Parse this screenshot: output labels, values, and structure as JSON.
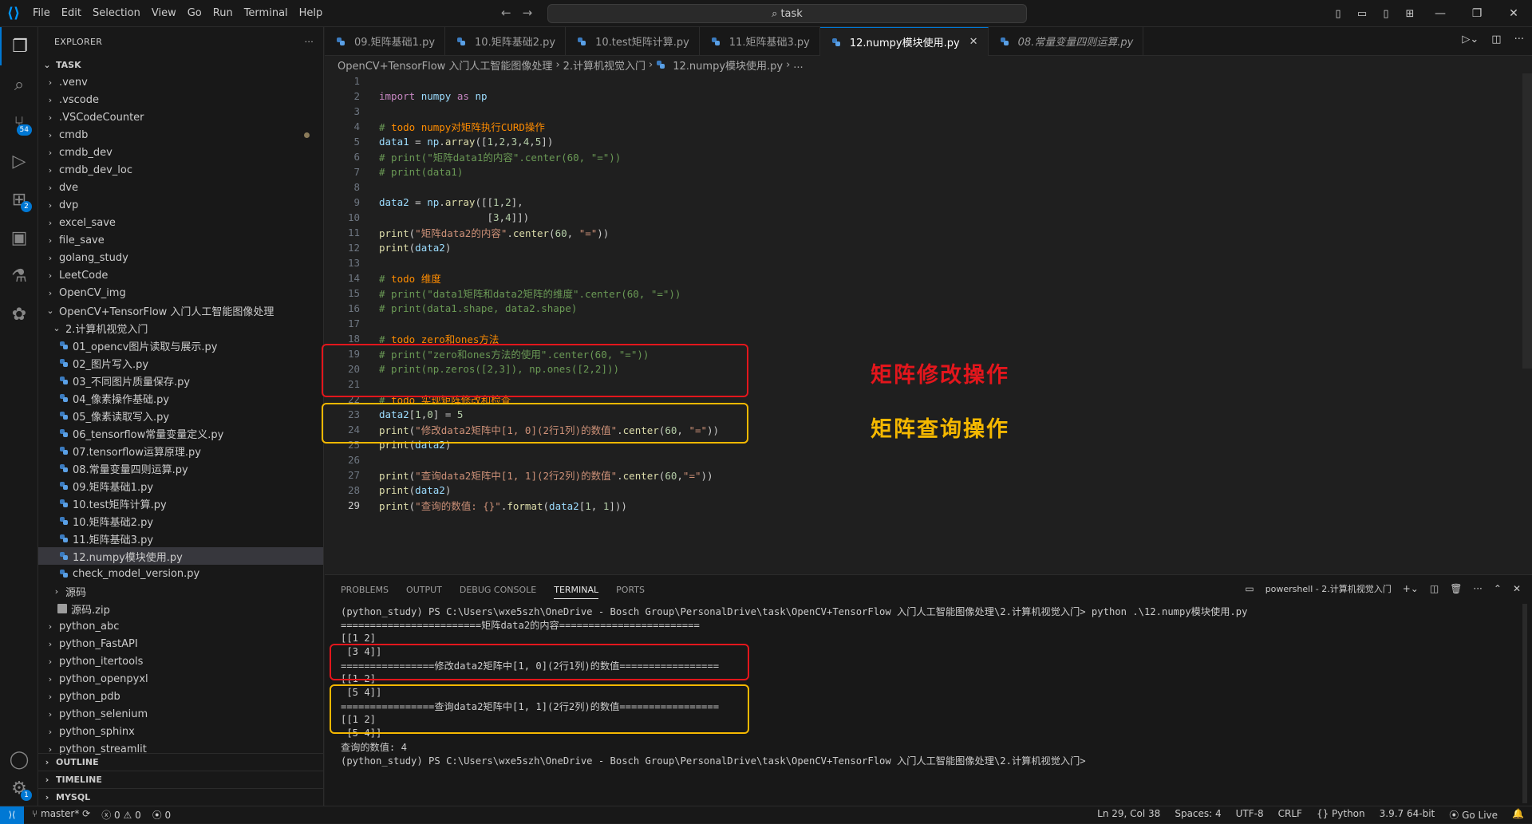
{
  "menu": [
    "File",
    "Edit",
    "Selection",
    "View",
    "Go",
    "Run",
    "Terminal",
    "Help"
  ],
  "search": "task",
  "explorer": {
    "title": "EXPLORER",
    "root": "TASK",
    "items": [
      {
        "label": ".venv",
        "type": "folder",
        "depth": 0
      },
      {
        "label": ".vscode",
        "type": "folder",
        "depth": 0
      },
      {
        "label": ".VSCodeCounter",
        "type": "folder",
        "depth": 0
      },
      {
        "label": "cmdb",
        "type": "folder",
        "depth": 0,
        "dot": true
      },
      {
        "label": "cmdb_dev",
        "type": "folder",
        "depth": 0
      },
      {
        "label": "cmdb_dev_loc",
        "type": "folder",
        "depth": 0
      },
      {
        "label": "dve",
        "type": "folder",
        "depth": 0
      },
      {
        "label": "dvp",
        "type": "folder",
        "depth": 0
      },
      {
        "label": "excel_save",
        "type": "folder",
        "depth": 0
      },
      {
        "label": "file_save",
        "type": "folder",
        "depth": 0
      },
      {
        "label": "golang_study",
        "type": "folder",
        "depth": 0
      },
      {
        "label": "LeetCode",
        "type": "folder",
        "depth": 0
      },
      {
        "label": "OpenCV_img",
        "type": "folder",
        "depth": 0
      },
      {
        "label": "OpenCV+TensorFlow 入门人工智能图像处理",
        "type": "open",
        "depth": 0
      },
      {
        "label": "2.计算机视觉入门",
        "type": "open",
        "depth": 1
      },
      {
        "label": "01_opencv图片读取与展示.py",
        "type": "py",
        "depth": 2
      },
      {
        "label": "02_图片写入.py",
        "type": "py",
        "depth": 2
      },
      {
        "label": "03_不同图片质量保存.py",
        "type": "py",
        "depth": 2
      },
      {
        "label": "04_像素操作基础.py",
        "type": "py",
        "depth": 2
      },
      {
        "label": "05_像素读取写入.py",
        "type": "py",
        "depth": 2
      },
      {
        "label": "06_tensorflow常量变量定义.py",
        "type": "py",
        "depth": 2
      },
      {
        "label": "07.tensorflow运算原理.py",
        "type": "py",
        "depth": 2
      },
      {
        "label": "08.常量变量四则运算.py",
        "type": "py",
        "depth": 2
      },
      {
        "label": "09.矩阵基础1.py",
        "type": "py",
        "depth": 2
      },
      {
        "label": "10.test矩阵计算.py",
        "type": "py",
        "depth": 2
      },
      {
        "label": "10.矩阵基础2.py",
        "type": "py",
        "depth": 2
      },
      {
        "label": "11.矩阵基础3.py",
        "type": "py",
        "depth": 2
      },
      {
        "label": "12.numpy模块使用.py",
        "type": "py",
        "depth": 2,
        "selected": true
      },
      {
        "label": "check_model_version.py",
        "type": "py",
        "depth": 2
      },
      {
        "label": "源码",
        "type": "folder",
        "depth": 1
      },
      {
        "label": "源码.zip",
        "type": "zip",
        "depth": 1
      },
      {
        "label": "python_abc",
        "type": "folder",
        "depth": 0
      },
      {
        "label": "python_FastAPI",
        "type": "folder",
        "depth": 0
      },
      {
        "label": "python_itertools",
        "type": "folder",
        "depth": 0
      },
      {
        "label": "python_openpyxl",
        "type": "folder",
        "depth": 0
      },
      {
        "label": "python_pdb",
        "type": "folder",
        "depth": 0
      },
      {
        "label": "python_selenium",
        "type": "folder",
        "depth": 0
      },
      {
        "label": "python_sphinx",
        "type": "folder",
        "depth": 0
      },
      {
        "label": "python_streamlit",
        "type": "folder",
        "depth": 0
      }
    ],
    "sections": [
      "OUTLINE",
      "TIMELINE",
      "MYSQL"
    ]
  },
  "activity": {
    "scm_badge": "54",
    "ext_badge": "2",
    "settings_badge": "1"
  },
  "tabs": [
    {
      "label": "09.矩阵基础1.py"
    },
    {
      "label": "10.矩阵基础2.py"
    },
    {
      "label": "10.test矩阵计算.py"
    },
    {
      "label": "11.矩阵基础3.py"
    },
    {
      "label": "12.numpy模块使用.py",
      "active": true
    },
    {
      "label": "08.常量变量四则运算.py",
      "italic": true
    }
  ],
  "breadcrumb": [
    "OpenCV+TensorFlow 入门人工智能图像处理",
    "2.计算机视觉入门",
    "12.numpy模块使用.py",
    "..."
  ],
  "code": [
    {
      "n": "1",
      "t": ""
    },
    {
      "n": "2",
      "t": "import numpy as np"
    },
    {
      "n": "3",
      "t": ""
    },
    {
      "n": "4",
      "t": "# todo numpy对矩阵执行CURD操作"
    },
    {
      "n": "5",
      "t": "data1 = np.array([1,2,3,4,5])"
    },
    {
      "n": "6",
      "t": "# print(\"矩阵data1的内容\".center(60, \"=\"))"
    },
    {
      "n": "7",
      "t": "# print(data1)"
    },
    {
      "n": "8",
      "t": ""
    },
    {
      "n": "9",
      "t": "data2 = np.array([[1,2],"
    },
    {
      "n": "10",
      "t": "                  [3,4]])"
    },
    {
      "n": "11",
      "t": "print(\"矩阵data2的内容\".center(60, \"=\"))"
    },
    {
      "n": "12",
      "t": "print(data2)"
    },
    {
      "n": "13",
      "t": ""
    },
    {
      "n": "14",
      "t": "# todo 维度"
    },
    {
      "n": "15",
      "t": "# print(\"data1矩阵和data2矩阵的维度\".center(60, \"=\"))"
    },
    {
      "n": "16",
      "t": "# print(data1.shape, data2.shape)"
    },
    {
      "n": "17",
      "t": ""
    },
    {
      "n": "18",
      "t": "# todo zero和ones方法"
    },
    {
      "n": "19",
      "t": "# print(\"zero和ones方法的使用\".center(60, \"=\"))"
    },
    {
      "n": "20",
      "t": "# print(np.zeros([2,3]), np.ones([2,2]))"
    },
    {
      "n": "21",
      "t": ""
    },
    {
      "n": "22",
      "t": "# todo 实现矩阵修改和检查"
    },
    {
      "n": "23",
      "t": "data2[1,0] = 5"
    },
    {
      "n": "24",
      "t": "print(\"修改data2矩阵中[1, 0](2行1列)的数值\".center(60, \"=\"))"
    },
    {
      "n": "25",
      "t": "print(data2)"
    },
    {
      "n": "26",
      "t": ""
    },
    {
      "n": "27",
      "t": "print(\"查询data2矩阵中[1, 1](2行2列)的数值\".center(60,\"=\"))"
    },
    {
      "n": "28",
      "t": "print(data2)"
    },
    {
      "n": "29",
      "t": "print(\"查询的数值: {}\".format(data2[1, 1]))"
    }
  ],
  "annotations": {
    "modify": "矩阵修改操作",
    "query": "矩阵查询操作",
    "modify_color": "#e3161c",
    "query_color": "#f5b800"
  },
  "panel": {
    "tabs": [
      "PROBLEMS",
      "OUTPUT",
      "DEBUG CONSOLE",
      "TERMINAL",
      "PORTS"
    ],
    "shell": "powershell - 2.计算机视觉入门"
  },
  "terminal": [
    "(python_study) PS C:\\Users\\wxe5szh\\OneDrive - Bosch Group\\PersonalDrive\\task\\OpenCV+TensorFlow 入门人工智能图像处理\\2.计算机视觉入门> python .\\12.numpy模块使用.py",
    "========================矩阵data2的内容========================",
    "[[1 2]",
    " [3 4]]",
    "================修改data2矩阵中[1, 0](2行1列)的数值=================",
    "[[1 2]",
    " [5 4]]",
    "================查询data2矩阵中[1, 1](2行2列)的数值=================",
    "[[1 2]",
    " [5 4]]",
    "查询的数值: 4",
    "(python_study) PS C:\\Users\\wxe5szh\\OneDrive - Bosch Group\\PersonalDrive\\task\\OpenCV+TensorFlow 入门人工智能图像处理\\2.计算机视觉入门> "
  ],
  "status": {
    "branch": "master*",
    "errors": "0",
    "warnings": "0",
    "ports": "0",
    "position": "Ln 29, Col 38",
    "spaces": "Spaces: 4",
    "encoding": "UTF-8",
    "eol": "CRLF",
    "lang": "Python",
    "interp": "3.9.7 64-bit",
    "golive": "Go Live"
  }
}
